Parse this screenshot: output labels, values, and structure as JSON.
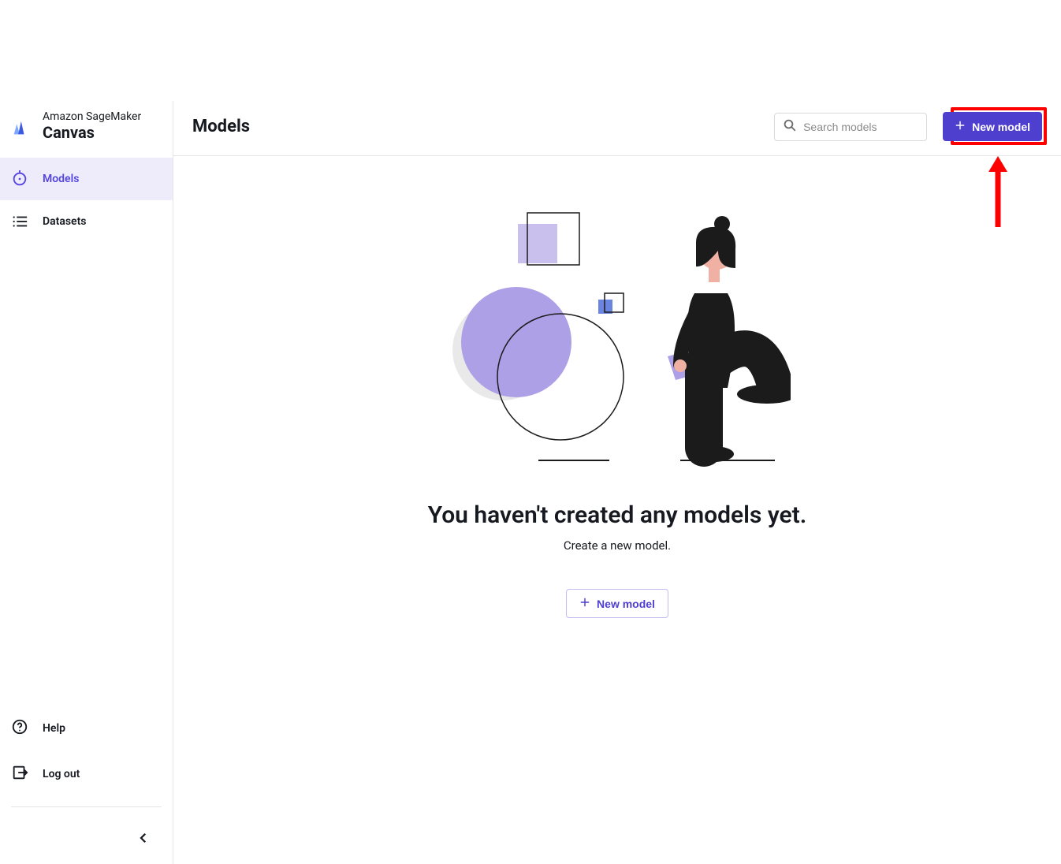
{
  "brand": {
    "sub": "Amazon SageMaker",
    "main": "Canvas"
  },
  "sidebar": {
    "items": [
      {
        "id": "models",
        "label": "Models",
        "icon": "target-bolt-icon",
        "active": true
      },
      {
        "id": "datasets",
        "label": "Datasets",
        "icon": "list-icon",
        "active": false
      }
    ],
    "footer": [
      {
        "id": "help",
        "label": "Help",
        "icon": "help-icon"
      },
      {
        "id": "logout",
        "label": "Log out",
        "icon": "logout-icon"
      }
    ]
  },
  "page": {
    "title": "Models",
    "search_placeholder": "Search models",
    "new_model_label": "New model"
  },
  "empty": {
    "title": "You haven't created any models yet.",
    "subtitle": "Create a new model.",
    "cta_label": "New model"
  },
  "annotation": {
    "type": "highlight",
    "target": "new-model-button",
    "arrow": true
  }
}
